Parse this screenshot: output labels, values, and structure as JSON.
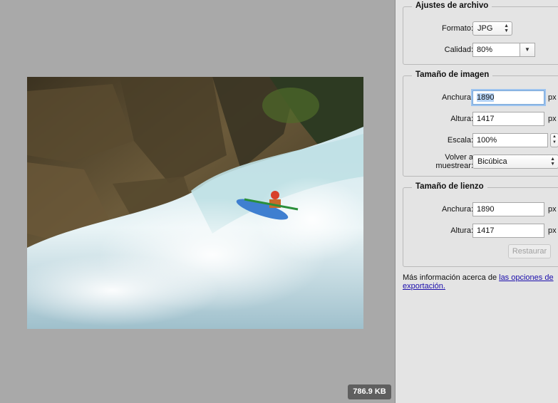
{
  "preview": {
    "file_size": "786.9 KB",
    "photo_alt": "kayaker on waterfall"
  },
  "file_settings": {
    "legend": "Ajustes de archivo",
    "format_label": "Formato:",
    "format_value": "JPG",
    "quality_label": "Calidad:",
    "quality_value": "80%"
  },
  "image_size": {
    "legend": "Tamaño de imagen",
    "width_label": "Anchura:",
    "width_value": "1890",
    "height_label": "Altura:",
    "height_value": "1417",
    "scale_label": "Escala:",
    "scale_value": "100%",
    "resample_label_line1": "Volver a",
    "resample_label_line2": "muestrear:",
    "resample_value": "Bicúbica",
    "unit": "px"
  },
  "canvas_size": {
    "legend": "Tamaño de lienzo",
    "width_label": "Anchura:",
    "width_value": "1890",
    "height_label": "Altura:",
    "height_value": "1417",
    "unit": "px",
    "restore_label": "Restaurar"
  },
  "info": {
    "text": "Más información acerca de ",
    "link_text": "las opciones de exportación."
  }
}
